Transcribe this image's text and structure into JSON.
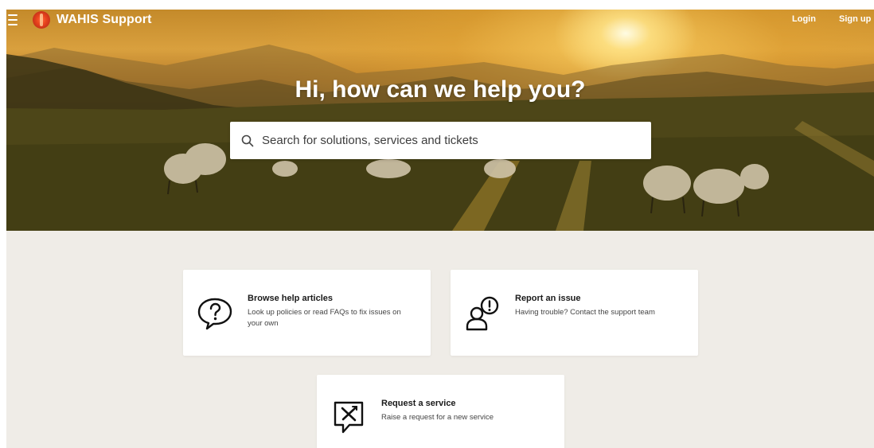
{
  "header": {
    "brand": "WAHIS Support",
    "login_label": "Login",
    "signup_label": "Sign up"
  },
  "hero": {
    "title": "Hi, how can we help you?",
    "search_placeholder": "Search for solutions, services and tickets"
  },
  "cards": [
    {
      "title": "Browse help articles",
      "description": "Look up policies or read FAQs to fix issues on your own",
      "icon": "question-bubble-icon"
    },
    {
      "title": "Report an issue",
      "description": "Having trouble? Contact the support team",
      "icon": "person-alert-icon"
    },
    {
      "title": "Request a service",
      "description": "Raise a request for a new service",
      "icon": "tools-bubble-icon"
    }
  ],
  "colors": {
    "page_background": "#efece7",
    "card_background": "#ffffff",
    "logo_red": "#e8431c"
  }
}
